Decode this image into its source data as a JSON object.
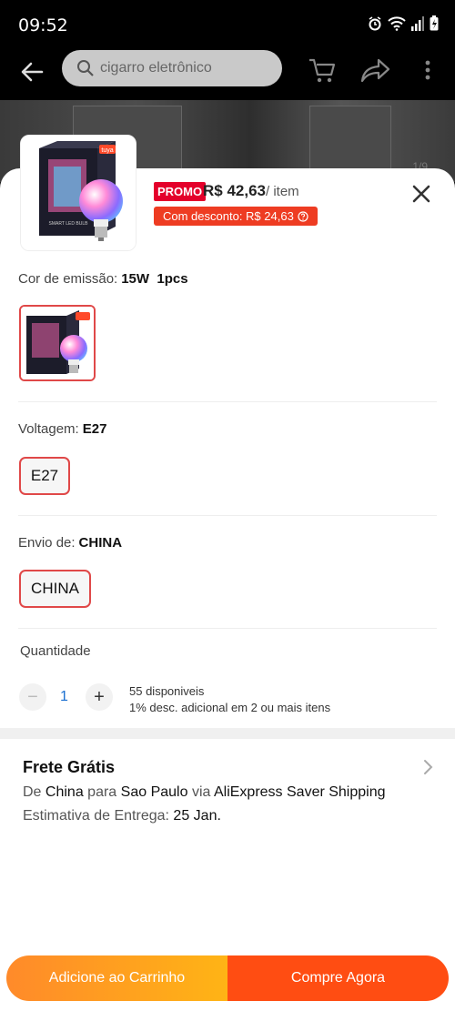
{
  "status_bar": {
    "time": "09:52"
  },
  "toolbar": {
    "search_text": "cigarro eletrônico"
  },
  "backdrop": {
    "pager": "1/9"
  },
  "product": {
    "promo_badge": "PROMO",
    "price": "R$ 42,63",
    "unit": "/ item",
    "discount_label": "Com desconto: R$ 24,63",
    "box_brand": "tuya",
    "box_text": "SMART LED BULB"
  },
  "color_section": {
    "label": "Cor de emissão:",
    "value": "15W  1pcs"
  },
  "voltage_section": {
    "label": "Voltagem:",
    "value": "E27",
    "options": [
      "E27"
    ]
  },
  "ship_from_section": {
    "label": "Envio de:",
    "value": "CHINA",
    "options": [
      "CHINA"
    ]
  },
  "quantity": {
    "label": "Quantidade",
    "minus": "−",
    "value": "1",
    "plus": "+",
    "stock": "55 disponiveis",
    "note": "1% desc. adicional em 2 ou mais itens"
  },
  "shipping": {
    "title": "Frete Grátis",
    "route_prefix": "De",
    "route_from": "China",
    "route_mid": "para",
    "route_to": "Sao Paulo",
    "route_via": "via",
    "route_method": "AliExpress Saver Shipping",
    "eta_label": "Estimativa de Entrega:",
    "eta_date": "25 Jan."
  },
  "actions": {
    "add_to_cart": "Adicione ao Carrinho",
    "buy_now": "Compre Agora"
  },
  "colors": {
    "promo": "#e4002b",
    "discount": "#ee3c22",
    "selected_border": "#e04848",
    "cart_button": "#ff9a20",
    "buy_button": "#ff4d12"
  }
}
